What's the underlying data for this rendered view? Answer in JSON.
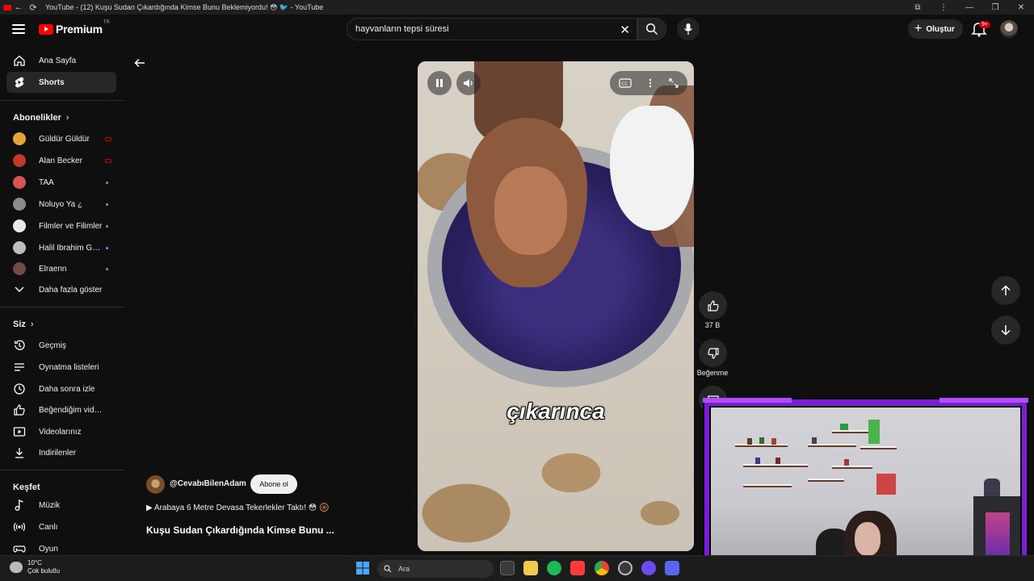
{
  "browser": {
    "tab_title": "YouTube - (12) Kuşu Sudan Çıkardığında Kimse Bunu Beklemiyordu! 😳 🐦 - YouTube"
  },
  "masthead": {
    "brand": "Premium",
    "region": "TR",
    "search_value": "hayvanların tepsi süresi",
    "create_label": "Oluştur",
    "notif_count": "9+"
  },
  "sidebar": {
    "main": [
      {
        "label": "Ana Sayfa",
        "icon": "home-icon"
      },
      {
        "label": "Shorts",
        "icon": "shorts-icon",
        "active": true
      }
    ],
    "subs_title": "Abonelikler",
    "subs": [
      {
        "label": "Güldür Güldür",
        "marker": "live",
        "avatar_color": "#e8a33b"
      },
      {
        "label": "Alan Becker",
        "marker": "live",
        "avatar_color": "#c0392b"
      },
      {
        "label": "TAA",
        "marker": "dot",
        "avatar_color": "#d9534f"
      },
      {
        "label": "Noluyo Ya ¿",
        "marker": "dot",
        "avatar_color": "#8a8a8a"
      },
      {
        "label": "Filmler ve Filimler",
        "marker": "dot",
        "avatar_color": "#e9e9e9"
      },
      {
        "label": "Halil İbrahim Gök...",
        "marker": "dot",
        "avatar_color": "#bdbdbd"
      },
      {
        "label": "Elraenn",
        "marker": "dot",
        "avatar_color": "#6d4c41"
      }
    ],
    "show_more": "Daha fazla göster",
    "you_title": "Siz",
    "you": [
      {
        "label": "Geçmiş",
        "icon": "history-icon"
      },
      {
        "label": "Oynatma listeleri",
        "icon": "playlist-icon"
      },
      {
        "label": "Daha sonra izle",
        "icon": "clock-icon"
      },
      {
        "label": "Beğendiğim videolar",
        "icon": "thumbs-up-icon"
      },
      {
        "label": "Videolarınız",
        "icon": "video-icon"
      },
      {
        "label": "İndirilenler",
        "icon": "download-icon"
      }
    ],
    "explore_title": "Keşfet",
    "explore": [
      {
        "label": "Müzik",
        "icon": "music-icon"
      },
      {
        "label": "Canlı",
        "icon": "live-icon"
      },
      {
        "label": "Oyun",
        "icon": "gaming-icon"
      }
    ]
  },
  "short": {
    "caption": "çıkarınca",
    "channel": "@CevabıBilenAdam",
    "subscribe": "Abone ol",
    "music": "▶ Arabaya 6 Metre Devasa Tekerlekler Taktı! 😳 🛞",
    "title": "Kuşu Sudan Çıkardığında Kimse Bunu ...",
    "likes": "37 B",
    "dislike_label": "Beğenme"
  },
  "taskbar": {
    "temp": "10°C",
    "weather": "Çok bulutlu",
    "search_placeholder": "Ara"
  },
  "colors": {
    "accent": "#ff0000",
    "overlay_frame": "#7c1cd6",
    "dot": "#3ea6ff"
  }
}
